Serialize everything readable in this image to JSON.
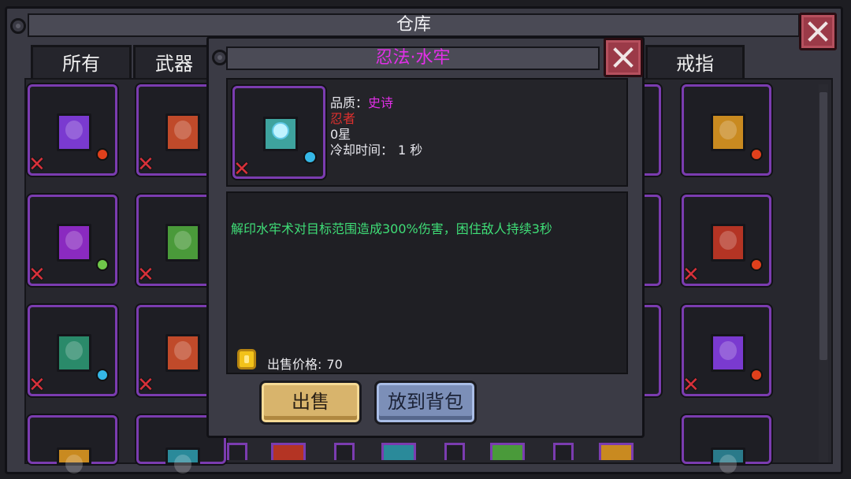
{
  "warehouse": {
    "title": "仓库",
    "tabs": [
      {
        "label": "所有"
      },
      {
        "label": "武器"
      },
      {
        "label": "戒指"
      }
    ]
  },
  "popup": {
    "title": "忍法·水牢",
    "quality_label": "品质：",
    "quality_value": "史诗",
    "class_label": "忍者",
    "stars": "0星",
    "cooldown_label": "冷却时间：",
    "cooldown_value": "1 秒",
    "description": "解印水牢术对目标范围造成300%伤害，困住敌人持续3秒",
    "price_label": "出售价格:",
    "price_value": "70",
    "sell_button": "出售",
    "put_in_bag_button": "放到背包"
  },
  "colors": {
    "rarity_epic": "#e22fe8",
    "class_text": "#e0302e",
    "description_text": "#3fde77",
    "slot_border": "#7b3cb0"
  },
  "grid": {
    "slots": [
      {
        "icon": "purple-grid-book-icon",
        "book": "#7a3ad0",
        "gem": "#e0401c",
        "marked": true
      },
      {
        "icon": "orange-fist-book-icon",
        "book": "#c04a2a",
        "gem": null,
        "marked": true
      },
      {
        "icon": "gold-grid-book-icon",
        "book": "#c98a20",
        "gem": "#e0401c",
        "marked": false
      },
      {
        "icon": "purple-cross-book-icon",
        "book": "#8a2ac0",
        "gem": "#6fc84a",
        "marked": true
      },
      {
        "icon": "green-bars-book-icon",
        "book": "#4a9a3a",
        "gem": null,
        "marked": true
      },
      {
        "icon": "red-swirl-book-icon",
        "book": "#b43424",
        "gem": "#e0401c",
        "marked": true
      },
      {
        "icon": "teal-shield-book-icon",
        "book": "#2a8a6a",
        "gem": "#35b7e6",
        "marked": true
      },
      {
        "icon": "orange-fist-book-icon",
        "book": "#c04a2a",
        "gem": null,
        "marked": true
      },
      {
        "icon": "purple-grid-book-icon",
        "book": "#7a3ad0",
        "gem": "#e0401c",
        "marked": true
      }
    ]
  }
}
